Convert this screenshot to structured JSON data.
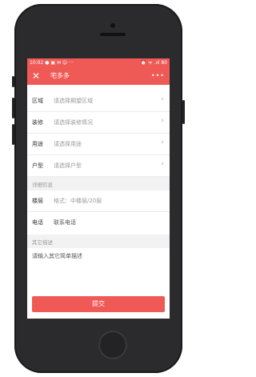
{
  "status": {
    "time": "10:02",
    "icons_left": "● ▣ ✉ ☺ ···",
    "icons_right": "⏰ ᯤ .ııl 80"
  },
  "appbar": {
    "close_label": "✕",
    "title": "宅多多",
    "more_label": "•••"
  },
  "form": {
    "rows": [
      {
        "label": "区域",
        "value": "请选择期望区域"
      },
      {
        "label": "装修",
        "value": "请选择装修情况"
      },
      {
        "label": "用途",
        "value": "请选择用途"
      },
      {
        "label": "户型",
        "value": "请选择户型"
      }
    ],
    "chevron": "›",
    "details_section": "详细信息",
    "floor": {
      "label": "楼层",
      "placeholder": "格式：中楼层/20层"
    },
    "phone": {
      "label": "电话",
      "placeholder": "联系电话"
    },
    "other_section": "其它描述",
    "description_placeholder": "请输入其它简单描述",
    "submit_label": "提交"
  }
}
